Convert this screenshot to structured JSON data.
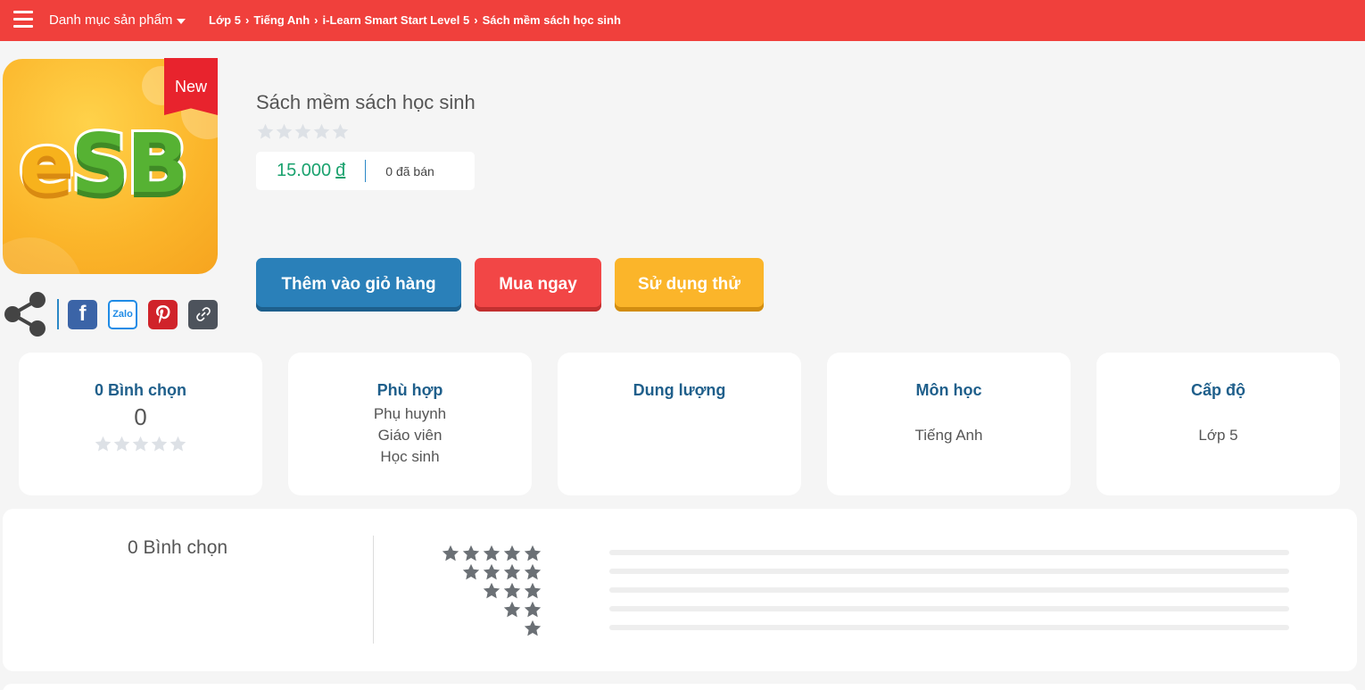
{
  "header": {
    "catalog_label": "Danh mục sản phẩm",
    "breadcrumb": [
      "Lớp 5",
      "Tiếng Anh",
      "i-Learn Smart Start Level 5",
      "Sách mềm sách học sinh"
    ],
    "bg_color": "#f0403c"
  },
  "product": {
    "image_text": "eSB",
    "badge": "New",
    "title": "Sách mềm sách học sinh",
    "rating_stars": 0,
    "price": "15.000",
    "currency": "đ",
    "sold": "0 đã bán"
  },
  "share": {
    "icons": [
      "share-icon",
      "facebook-icon",
      "zalo-icon",
      "pinterest-icon",
      "link-icon"
    ],
    "zalo_label": "Zalo"
  },
  "actions": {
    "add_to_cart": "Thêm vào giỏ hàng",
    "buy_now": "Mua ngay",
    "try": "Sử dụng thử"
  },
  "info_cards": {
    "votes": {
      "title": "0 Bình chọn",
      "value": "0"
    },
    "suitable": {
      "title": "Phù hợp",
      "values": [
        "Phụ huynh",
        "Giáo viên",
        "Học sinh"
      ]
    },
    "capacity": {
      "title": "Dung lượng"
    },
    "subject": {
      "title": "Môn học",
      "value": "Tiếng Anh"
    },
    "level": {
      "title": "Cấp độ",
      "value": "Lớp 5"
    }
  },
  "rating_panel": {
    "title": "0 Bình chọn",
    "rows": [
      {
        "stars": 5,
        "fill": 0
      },
      {
        "stars": 4,
        "fill": 0
      },
      {
        "stars": 3,
        "fill": 0
      },
      {
        "stars": 2,
        "fill": 0
      },
      {
        "stars": 1,
        "fill": 0
      }
    ]
  },
  "colors": {
    "primary_blue": "#2a80b9",
    "red": "#f24646",
    "yellow": "#fbb52a",
    "price_green": "#1aa26e"
  }
}
